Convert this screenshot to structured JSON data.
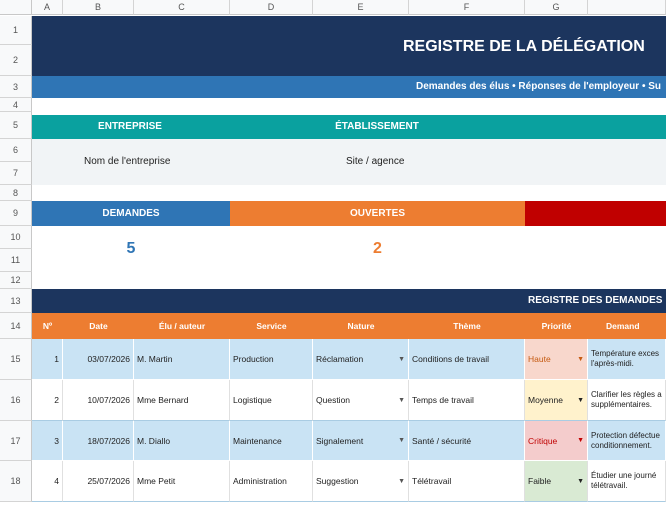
{
  "columns": [
    "A",
    "B",
    "C",
    "D",
    "E",
    "F",
    "G"
  ],
  "rows": [
    "1",
    "2",
    "3",
    "4",
    "5",
    "6",
    "7",
    "8",
    "9",
    "10",
    "11",
    "12",
    "13",
    "14",
    "15",
    "16",
    "17",
    "18"
  ],
  "title": "REGISTRE DE LA DÉLÉGATION",
  "subtitle": "Demandes des élus • Réponses de l'employeur • Su",
  "company": {
    "header_left": "ENTREPRISE",
    "header_right": "ÉTABLISSEMENT",
    "value_left": "Nom de l'entreprise",
    "value_right": "Site / agence"
  },
  "kpis": [
    {
      "label": "DEMANDES",
      "value": "5",
      "color": "#2f75b5"
    },
    {
      "label": "OUVERTES",
      "value": "2",
      "color": "#ed7d31"
    },
    {
      "label": "",
      "value": "",
      "color": "#c00000"
    }
  ],
  "register": {
    "title": "REGISTRE DES DEMANDES",
    "headers": [
      "Nº",
      "Date",
      "Élu / auteur",
      "Service",
      "Nature",
      "Thème",
      "Priorité",
      "Demand"
    ],
    "rows": [
      {
        "n": "1",
        "date": "03/07/2026",
        "author": "M. Martin",
        "service": "Production",
        "nature": "Réclamation",
        "theme": "Conditions de travail",
        "priority": "Haute",
        "priority_color": "#f8d7cc",
        "priority_text": "#c55a11",
        "request": "Température exces l'après-midi."
      },
      {
        "n": "2",
        "date": "10/07/2026",
        "author": "Mme Bernard",
        "service": "Logistique",
        "nature": "Question",
        "theme": "Temps de travail",
        "priority": "Moyenne",
        "priority_color": "#fff2cc",
        "priority_text": "#222222",
        "request": "Clarifier les règles a supplémentaires."
      },
      {
        "n": "3",
        "date": "18/07/2026",
        "author": "M. Diallo",
        "service": "Maintenance",
        "nature": "Signalement",
        "theme": "Santé / sécurité",
        "priority": "Critique",
        "priority_color": "#f4cccc",
        "priority_text": "#c00000",
        "request": "Protection défectue conditionnement."
      },
      {
        "n": "4",
        "date": "25/07/2026",
        "author": "Mme Petit",
        "service": "Administration",
        "nature": "Suggestion",
        "theme": "Télétravail",
        "priority": "Faible",
        "priority_color": "#d9ead3",
        "priority_text": "#222222",
        "request": "Étudier une journé télétravail."
      }
    ]
  }
}
